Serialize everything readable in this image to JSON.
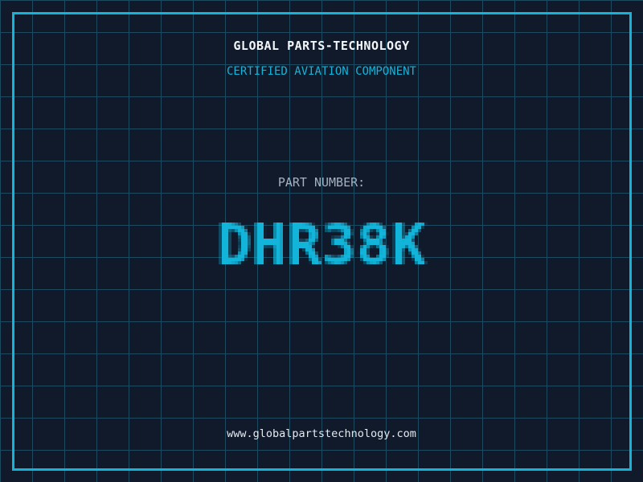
{
  "theme": {
    "background": "#101a2b",
    "grid_line": "#1c4a60",
    "accent": "#12b4da",
    "title_color": "#f2f6f9",
    "label_color": "#a4b2c2",
    "url_color": "#e4eaef"
  },
  "header": {
    "title": "GLOBAL PARTS-TECHNOLOGY",
    "subtitle": "CERTIFIED AVIATION COMPONENT"
  },
  "part": {
    "label": "PART NUMBER:",
    "number": "DHR38K"
  },
  "footer": {
    "website": "www.globalpartstechnology.com"
  }
}
